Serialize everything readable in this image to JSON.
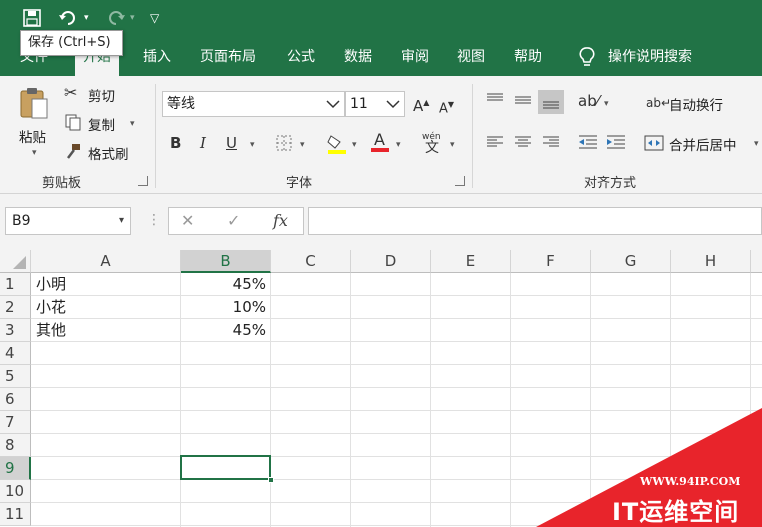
{
  "quick_access": {
    "save_icon": "save-icon",
    "undo_icon": "undo-icon",
    "redo_icon": "redo-icon",
    "customize_icon": "customize-qat-icon"
  },
  "tooltip": "保存 (Ctrl+S)",
  "tabs": [
    "文件",
    "开始",
    "插入",
    "页面布局",
    "公式",
    "数据",
    "审阅",
    "视图",
    "帮助"
  ],
  "active_tab": "开始",
  "tell_me": "操作说明搜索",
  "ribbon": {
    "clipboard": {
      "paste": "粘贴",
      "cut": "剪切",
      "copy": "复制",
      "format_painter": "格式刷",
      "label": "剪贴板"
    },
    "font": {
      "name": "等线",
      "size": "11",
      "bold": "B",
      "italic": "I",
      "underline": "U",
      "label": "字体",
      "phonetic": "wén"
    },
    "alignment": {
      "wrap_text": "自动换行",
      "merge_center": "合并后居中",
      "label": "对齐方式"
    }
  },
  "formula_bar": {
    "name_box": "B9",
    "cancel": "✕",
    "enter": "✓",
    "fx": "fx",
    "formula": ""
  },
  "columns": [
    "A",
    "B",
    "C",
    "D",
    "E",
    "F",
    "G",
    "H"
  ],
  "selected_column": "B",
  "rows": [
    "1",
    "2",
    "3",
    "4",
    "5",
    "6",
    "7",
    "8",
    "9",
    "10",
    "11"
  ],
  "selected_row": "9",
  "cells": [
    {
      "name": "小明",
      "value": "45%"
    },
    {
      "name": "小花",
      "value": "10%"
    },
    {
      "name": "其他",
      "value": "45%"
    }
  ],
  "watermark": {
    "url": "WWW.94IP.COM",
    "name": "IT运维空间"
  },
  "colors": {
    "accent": "#217346",
    "ribbon_bg": "#f3f3f3",
    "watermark_red": "#e8242b"
  }
}
